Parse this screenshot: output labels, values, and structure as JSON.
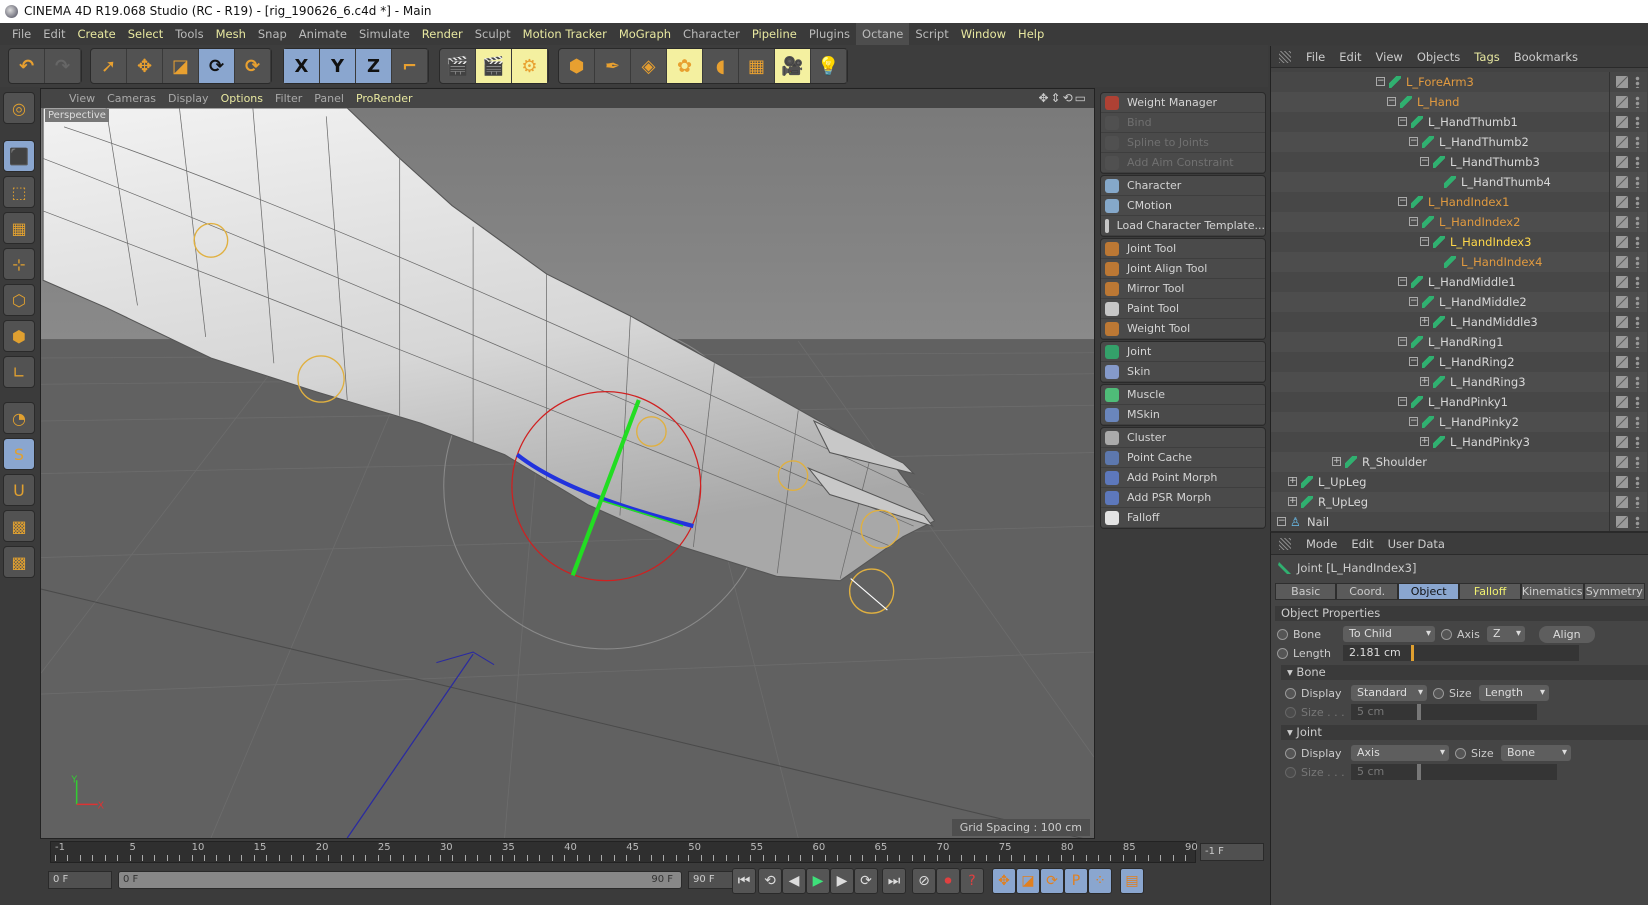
{
  "window": {
    "title": "CINEMA 4D R19.068 Studio (RC - R19) - [rig_190626_6.c4d *] - Main"
  },
  "menubar": [
    {
      "label": "File",
      "hl": false
    },
    {
      "label": "Edit",
      "hl": false
    },
    {
      "label": "Create",
      "hl": true
    },
    {
      "label": "Select",
      "hl": true
    },
    {
      "label": "Tools",
      "hl": false
    },
    {
      "label": "Mesh",
      "hl": true
    },
    {
      "label": "Snap",
      "hl": false
    },
    {
      "label": "Animate",
      "hl": false
    },
    {
      "label": "Simulate",
      "hl": false
    },
    {
      "label": "Render",
      "hl": true
    },
    {
      "label": "Sculpt",
      "hl": false
    },
    {
      "label": "Motion Tracker",
      "hl": true
    },
    {
      "label": "MoGraph",
      "hl": true
    },
    {
      "label": "Character",
      "hl": false
    },
    {
      "label": "Pipeline",
      "hl": true
    },
    {
      "label": "Plugins",
      "hl": false
    },
    {
      "label": "Octane",
      "hl": false,
      "active": true
    },
    {
      "label": "Script",
      "hl": false
    },
    {
      "label": "Window",
      "hl": true
    },
    {
      "label": "Help",
      "hl": true
    }
  ],
  "toolbar": {
    "groups": [
      [
        {
          "icon": "undo-icon",
          "glyph": "↶"
        },
        {
          "icon": "redo-icon",
          "glyph": "↷",
          "disabled": true
        }
      ],
      [
        {
          "icon": "live-selection-icon",
          "glyph": "➚"
        },
        {
          "icon": "move-icon",
          "glyph": "✥"
        },
        {
          "icon": "scale-icon",
          "glyph": "◪"
        },
        {
          "icon": "rotate-icon",
          "glyph": "⟳",
          "on": true
        },
        {
          "icon": "recent-tool-icon",
          "glyph": "⟳"
        }
      ],
      [
        {
          "icon": "x-axis-icon",
          "glyph": "X",
          "on": true
        },
        {
          "icon": "y-axis-icon",
          "glyph": "Y",
          "on": true
        },
        {
          "icon": "z-axis-icon",
          "glyph": "Z",
          "on": true
        },
        {
          "icon": "coordinate-system-icon",
          "glyph": "⌐"
        }
      ],
      [
        {
          "icon": "render-view-icon",
          "glyph": "🎬"
        },
        {
          "icon": "render-picture-viewer-icon",
          "glyph": "🎬",
          "yel": true
        },
        {
          "icon": "render-settings-icon",
          "glyph": "⚙",
          "yel": true
        }
      ],
      [
        {
          "icon": "cube-icon",
          "glyph": "⬢"
        },
        {
          "icon": "pen-icon",
          "glyph": "✒"
        },
        {
          "icon": "subdivision-surface-icon",
          "glyph": "◈"
        },
        {
          "icon": "cloner-icon",
          "glyph": "✿",
          "yel": true
        },
        {
          "icon": "deformer-icon",
          "glyph": "◖"
        },
        {
          "icon": "floor-icon",
          "glyph": "▦"
        },
        {
          "icon": "camera-icon",
          "glyph": "🎥",
          "yel": true
        },
        {
          "icon": "light-icon",
          "glyph": "💡"
        }
      ]
    ]
  },
  "leftbar": [
    "make-editable-icon",
    "model-mode-icon",
    "texture-mode-icon",
    "workplane-mode-icon",
    "points-mode-icon",
    "edges-mode-icon",
    "polygons-mode-icon",
    "enable-axis-icon",
    "tweak-mode-icon",
    "solo-icon",
    "snap-icon",
    "lock-workplane-icon",
    "planar-workplane-icon"
  ],
  "viewport": {
    "menu": [
      {
        "label": "View",
        "hl": false
      },
      {
        "label": "Cameras",
        "hl": false
      },
      {
        "label": "Display",
        "hl": false
      },
      {
        "label": "Options",
        "hl": true
      },
      {
        "label": "Filter",
        "hl": false
      },
      {
        "label": "Panel",
        "hl": false
      },
      {
        "label": "ProRender",
        "hl": true
      }
    ],
    "camera_label": "Perspective",
    "grid_spacing": "Grid Spacing : 100 cm",
    "axis_y": "Y",
    "axis_x": "X"
  },
  "character_menu": {
    "groups": [
      [
        {
          "label": "Weight Manager",
          "icon": "weight-manager-icon",
          "color": "#c04030"
        },
        {
          "label": "Bind",
          "icon": "bind-icon",
          "disabled": true
        },
        {
          "label": "Spline to Joints",
          "icon": "spline-to-joints-icon",
          "disabled": true
        },
        {
          "label": "Add Aim Constraint",
          "icon": "aim-constraint-icon",
          "disabled": true
        }
      ],
      [
        {
          "label": "Character",
          "icon": "character-icon",
          "color": "#8fb8e0"
        },
        {
          "label": "CMotion",
          "icon": "cmotion-icon",
          "color": "#8fb8e0"
        },
        {
          "label": "Load Character Template...",
          "icon": "load-template-icon",
          "color": "#dddddd"
        }
      ],
      [
        {
          "label": "Joint Tool",
          "icon": "joint-tool-icon",
          "color": "#d08030"
        },
        {
          "label": "Joint Align Tool",
          "icon": "joint-align-tool-icon",
          "color": "#d08030"
        },
        {
          "label": "Mirror Tool",
          "icon": "mirror-tool-icon",
          "color": "#d08030"
        },
        {
          "label": "Paint Tool",
          "icon": "paint-tool-icon",
          "color": "#dddddd"
        },
        {
          "label": "Weight Tool",
          "icon": "weight-tool-icon",
          "color": "#d08030"
        }
      ],
      [
        {
          "label": "Joint",
          "icon": "joint-icon",
          "color": "#30b070"
        },
        {
          "label": "Skin",
          "icon": "skin-icon",
          "color": "#8fa8e0"
        }
      ],
      [
        {
          "label": "Muscle",
          "icon": "muscle-icon",
          "color": "#50d080"
        },
        {
          "label": "MSkin",
          "icon": "mskin-icon",
          "color": "#7090d0"
        }
      ],
      [
        {
          "label": "Cluster",
          "icon": "cluster-icon",
          "color": "#bbbbbb"
        },
        {
          "label": "Point Cache",
          "icon": "point-cache-icon",
          "color": "#6080c0"
        },
        {
          "label": "Add Point Morph",
          "icon": "point-morph-icon",
          "color": "#6080d0"
        },
        {
          "label": "Add PSR Morph",
          "icon": "psr-morph-icon",
          "color": "#6080d0"
        },
        {
          "label": "Falloff",
          "icon": "falloff-icon",
          "color": "#ffffff"
        }
      ]
    ]
  },
  "object_manager": {
    "menu": [
      {
        "label": "File",
        "hl": false
      },
      {
        "label": "Edit",
        "hl": false
      },
      {
        "label": "View",
        "hl": false
      },
      {
        "label": "Objects",
        "hl": false
      },
      {
        "label": "Tags",
        "hl": true
      },
      {
        "label": "Bookmarks",
        "hl": false
      }
    ],
    "rows": [
      {
        "name": "L_ForeArm3",
        "depth": 9,
        "exp": "-",
        "state": "selected"
      },
      {
        "name": "L_Hand",
        "depth": 10,
        "exp": "-",
        "state": "selected"
      },
      {
        "name": "L_HandThumb1",
        "depth": 11,
        "exp": "-",
        "state": "normal"
      },
      {
        "name": "L_HandThumb2",
        "depth": 12,
        "exp": "-",
        "state": "normal"
      },
      {
        "name": "L_HandThumb3",
        "depth": 13,
        "exp": "-",
        "state": "normal"
      },
      {
        "name": "L_HandThumb4",
        "depth": 14,
        "exp": "",
        "state": "normal"
      },
      {
        "name": "L_HandIndex1",
        "depth": 11,
        "exp": "-",
        "state": "selected"
      },
      {
        "name": "L_HandIndex2",
        "depth": 12,
        "exp": "-",
        "state": "selected"
      },
      {
        "name": "L_HandIndex3",
        "depth": 13,
        "exp": "-",
        "state": "active"
      },
      {
        "name": "L_HandIndex4",
        "depth": 14,
        "exp": "",
        "state": "selected"
      },
      {
        "name": "L_HandMiddle1",
        "depth": 11,
        "exp": "-",
        "state": "normal"
      },
      {
        "name": "L_HandMiddle2",
        "depth": 12,
        "exp": "-",
        "state": "normal"
      },
      {
        "name": "L_HandMiddle3",
        "depth": 13,
        "exp": "+",
        "state": "normal"
      },
      {
        "name": "L_HandRing1",
        "depth": 11,
        "exp": "-",
        "state": "normal"
      },
      {
        "name": "L_HandRing2",
        "depth": 12,
        "exp": "-",
        "state": "normal"
      },
      {
        "name": "L_HandRing3",
        "depth": 13,
        "exp": "+",
        "state": "normal"
      },
      {
        "name": "L_HandPinky1",
        "depth": 11,
        "exp": "-",
        "state": "normal"
      },
      {
        "name": "L_HandPinky2",
        "depth": 12,
        "exp": "-",
        "state": "normal"
      },
      {
        "name": "L_HandPinky3",
        "depth": 13,
        "exp": "+",
        "state": "normal"
      },
      {
        "name": "R_Shoulder",
        "depth": 5,
        "exp": "+",
        "state": "normal"
      },
      {
        "name": "L_UpLeg",
        "depth": 1,
        "exp": "+",
        "state": "normal"
      },
      {
        "name": "R_UpLeg",
        "depth": 1,
        "exp": "+",
        "state": "normal"
      },
      {
        "name": "Nail",
        "depth": 0,
        "exp": "-",
        "state": "normal",
        "icon": "null-figure-icon"
      }
    ]
  },
  "attributes": {
    "menu": [
      {
        "label": "Mode",
        "hl": false
      },
      {
        "label": "Edit",
        "hl": false
      },
      {
        "label": "User Data",
        "hl": false
      }
    ],
    "title": "Joint [L_HandIndex3]",
    "tabs": [
      {
        "label": "Basic"
      },
      {
        "label": "Coord."
      },
      {
        "label": "Object",
        "active": true
      },
      {
        "label": "Falloff",
        "yel": true
      },
      {
        "label": "Kinematics"
      },
      {
        "label": "Symmetry"
      }
    ],
    "section_object": "Object Properties",
    "bone_label": "Bone",
    "bone_value": "To Child",
    "axis_label": "Axis",
    "axis_value": "Z",
    "align_label": "Align",
    "length_label": "Length",
    "length_value": "2.181 cm",
    "length_slider": 0.01,
    "section_bone": "▾ Bone",
    "bone_display_label": "Display",
    "bone_display_value": "Standard",
    "bone_size_label": "Size",
    "bone_size_value": "Length",
    "bone_size2_label": "Size . . .",
    "bone_size2_value": "5 cm",
    "section_joint": "▾ Joint",
    "joint_display_label": "Display",
    "joint_display_value": "Axis",
    "joint_size_label": "Size",
    "joint_size_value": "Bone",
    "joint_size2_label": "Size . . .",
    "joint_size2_value": "5 cm"
  },
  "timeline": {
    "ticks": [
      "-1",
      "5",
      "10",
      "15",
      "20",
      "25",
      "30",
      "35",
      "40",
      "45",
      "50",
      "55",
      "60",
      "65",
      "70",
      "75",
      "80",
      "85",
      "90"
    ],
    "current_frame": "-1 F",
    "start_field": "0 F",
    "range_start": "0 F",
    "range_end": "90 F",
    "end_field": "90 F",
    "controls": [
      "go-to-start-icon",
      "previous-key-icon",
      "step-back-icon",
      "play-icon",
      "step-forward-icon",
      "next-key-icon",
      "go-to-end-icon",
      "record-disabled-icon",
      "autokey-icon",
      "keyframe-selection-icon",
      "position-key-icon",
      "scale-key-icon",
      "rotation-key-icon",
      "parameter-key-icon",
      "point-level-icon",
      "timeline-icon"
    ]
  }
}
